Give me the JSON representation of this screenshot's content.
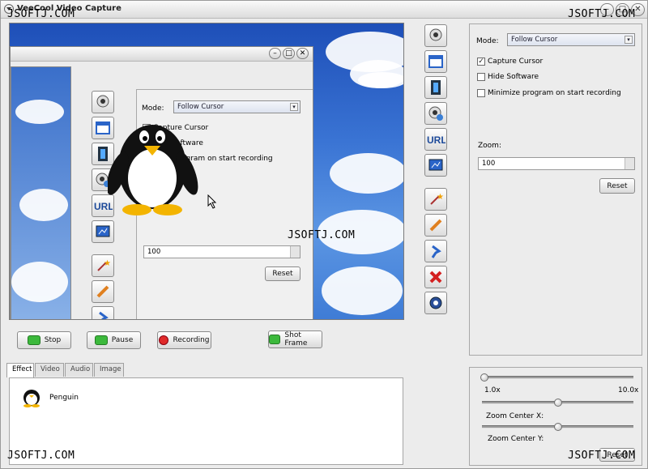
{
  "window": {
    "title": "VeeCool Video Capture"
  },
  "watermark": "JSOFTJ.COM",
  "settings": {
    "mode_label": "Mode:",
    "mode_value": "Follow Cursor",
    "capture_cursor": "Capture Cursor",
    "capture_cursor_checked": true,
    "hide_software": "Hide Software",
    "minimize_program": "Minimize program on start recording",
    "zoom_label": "Zoom:",
    "zoom_value": "100",
    "reset_label": "Reset"
  },
  "inner": {
    "mode_label": "Mode:",
    "mode_value": "Follow Cursor",
    "capture_cursor": "Capture Cursor",
    "hide_software_partial": "oftware",
    "minimize_partial": "ogram on start recording",
    "zoom_value": "100",
    "reset_label": "Reset"
  },
  "controls": {
    "stop": "Stop",
    "pause": "Pause",
    "recording": "Recording",
    "shot_frame": "Shot Frame"
  },
  "tabs": [
    "Effect",
    "Video",
    "Audio",
    "Image"
  ],
  "effects": [
    {
      "label": "Penguin"
    }
  ],
  "zoom_panel": {
    "scale_min": "1.0x",
    "scale_max": "10.0x",
    "zoom_level": 0.0,
    "zoom_center_x_label": "Zoom Center X:",
    "zoom_center_x": 0.5,
    "zoom_center_y_label": "Zoom Center Y:",
    "zoom_center_y": 0.5,
    "reset_label": "Reset"
  },
  "tool_icons": [
    "webcam-icon",
    "window-icon",
    "film-icon",
    "webcam-effect-icon",
    "url-icon",
    "screen-region-icon",
    "magic-wand-icon",
    "pencil-icon",
    "pin-icon",
    "delete-icon",
    "gear-icon"
  ]
}
